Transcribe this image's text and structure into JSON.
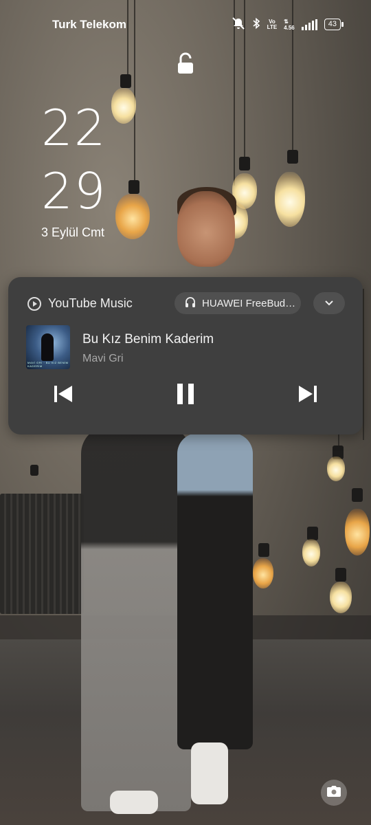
{
  "status_bar": {
    "carrier": "Turk Telekom",
    "icons": [
      "mute-icon",
      "bluetooth-icon",
      "volte-icon",
      "data-speed-icon",
      "signal-icon",
      "battery-icon"
    ],
    "volte_top": "Vo",
    "volte_bottom": "LTE",
    "data_speed": "4.56",
    "battery_level": "43"
  },
  "lockscreen": {
    "lock_icon": "lock-open-icon",
    "clock_hour": "22",
    "clock_minute": "29",
    "date": "3 Eylül Cmt"
  },
  "media_player": {
    "app_name": "YouTube Music",
    "output_device": "HUAWEI FreeBud…",
    "song_title": "Bu Kız Benim Kaderim",
    "artist": "Mavi Gri",
    "album_art_text": "MAVİ GRİ · BU KIZ BENİM KADERİM",
    "controls": [
      "previous-icon",
      "pause-icon",
      "next-icon"
    ],
    "card_color": "#3f3f3f"
  },
  "shortcuts": {
    "camera": "camera-icon"
  }
}
